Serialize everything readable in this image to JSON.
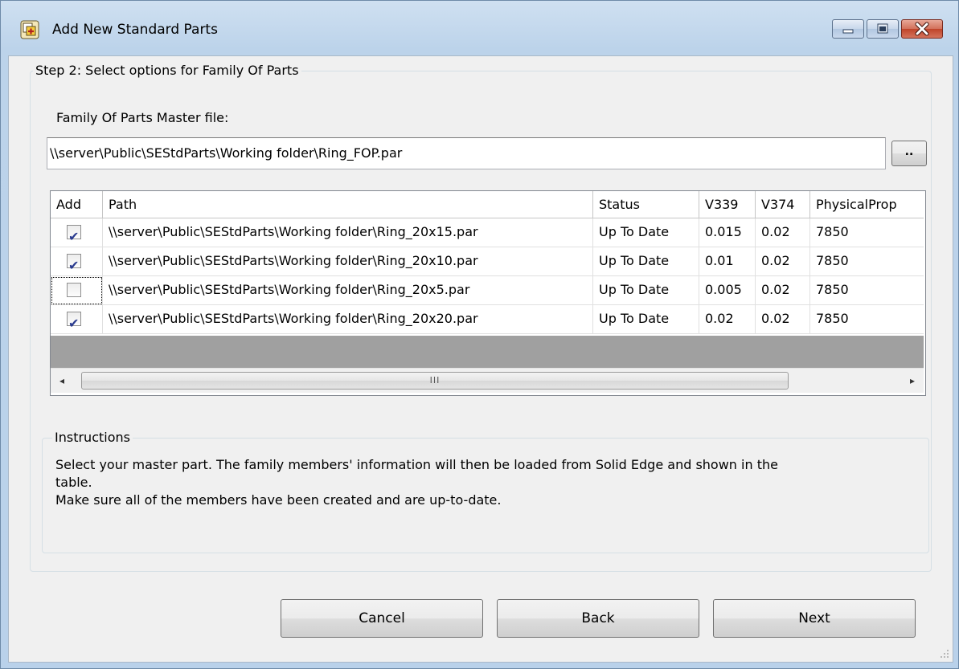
{
  "window": {
    "title": "Add New Standard Parts"
  },
  "step_group": {
    "legend": "Step 2: Select options for Family Of Parts",
    "master_file_label": "Family Of Parts Master file:",
    "master_file_value": "\\\\server\\Public\\SEStdParts\\Working folder\\Ring_FOP.par",
    "browse_label": ".."
  },
  "table": {
    "columns": [
      "Add",
      "Path",
      "Status",
      "V339",
      "V374",
      "PhysicalProp"
    ],
    "rows": [
      {
        "checked": true,
        "path": "\\\\server\\Public\\SEStdParts\\Working folder\\Ring_20x15.par",
        "status": "Up To Date",
        "v339": "0.015",
        "v374": "0.02",
        "phys": "7850"
      },
      {
        "checked": true,
        "path": "\\\\server\\Public\\SEStdParts\\Working folder\\Ring_20x10.par",
        "status": "Up To Date",
        "v339": "0.01",
        "v374": "0.02",
        "phys": "7850"
      },
      {
        "checked": false,
        "path": "\\\\server\\Public\\SEStdParts\\Working folder\\Ring_20x5.par",
        "status": "Up To Date",
        "v339": "0.005",
        "v374": "0.02",
        "phys": "7850"
      },
      {
        "checked": true,
        "path": "\\\\server\\Public\\SEStdParts\\Working folder\\Ring_20x20.par",
        "status": "Up To Date",
        "v339": "0.02",
        "v374": "0.02",
        "phys": "7850"
      }
    ],
    "check_glyph": "✔",
    "scroll_left": "◂",
    "scroll_right": "▸",
    "thumb_grip": "III"
  },
  "instructions": {
    "legend": "Instructions",
    "line1": "Select your master part. The family members' information will then be loaded from Solid Edge and shown in the",
    "line2": "table.",
    "line3": "Make sure all of the members have been created and are up-to-date."
  },
  "buttons": {
    "cancel": "Cancel",
    "back": "Back",
    "next": "Next"
  }
}
